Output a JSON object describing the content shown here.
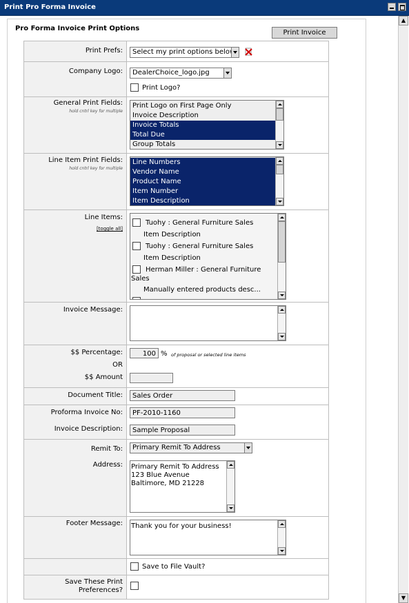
{
  "window": {
    "title": "Print Pro Forma Invoice"
  },
  "heading": "Pro Forma Invoice Print Options",
  "print_button": "Print Invoice",
  "rows": {
    "print_prefs": {
      "label": "Print Prefs:",
      "value": "Select my print options below"
    },
    "company_logo": {
      "label": "Company Logo:",
      "value": "DealerChoice_logo.jpg",
      "print_logo_label": "Print Logo?"
    },
    "general_print_fields": {
      "label": "General Print Fields:",
      "hint": "hold cntrl key for multiple",
      "options": [
        {
          "text": "Print Logo on First Page Only",
          "selected": false
        },
        {
          "text": "Invoice Description",
          "selected": false
        },
        {
          "text": "Invoice Totals",
          "selected": true
        },
        {
          "text": "Total Due",
          "selected": true
        },
        {
          "text": "Group Totals",
          "selected": false
        }
      ]
    },
    "line_item_print_fields": {
      "label": "Line Item Print Fields:",
      "hint": "hold cntrl key for multiple",
      "options": [
        {
          "text": "Line Numbers",
          "selected": true
        },
        {
          "text": "Vendor Name",
          "selected": true
        },
        {
          "text": "Product Name",
          "selected": true
        },
        {
          "text": "Item Number",
          "selected": true
        },
        {
          "text": "Item Description",
          "selected": true
        }
      ]
    },
    "line_items": {
      "label": "Line Items:",
      "toggle": "[toggle all]",
      "items": [
        {
          "vendor": "Tuohy : General Furniture Sales",
          "wrap": "",
          "desc": "Item Description"
        },
        {
          "vendor": "Tuohy : General Furniture Sales",
          "wrap": "",
          "desc": "Item Description"
        },
        {
          "vendor": "Herman Miller : General Furniture",
          "wrap": "Sales",
          "desc": "Manually entered products desc..."
        }
      ]
    },
    "invoice_message": {
      "label": "Invoice Message:",
      "value": ""
    },
    "percentage": {
      "label": "$$ Percentage:",
      "value": "100",
      "unit": "%",
      "note": "of proposal or selected line items",
      "or": "OR"
    },
    "amount": {
      "label": "$$ Amount",
      "value": ""
    },
    "document_title": {
      "label": "Document Title:",
      "value": "Sales Order"
    },
    "proforma_no": {
      "label": "Proforma Invoice No:",
      "value": "PF-2010-1160"
    },
    "invoice_description": {
      "label": "Invoice Description:",
      "value": "Sample Proposal"
    },
    "remit_to": {
      "label": "Remit To:",
      "value": "Primary Remit To Address"
    },
    "address": {
      "label": "Address:",
      "lines": [
        "Primary Remit To Address",
        "123 Blue Avenue",
        "Baltimore, MD 21228"
      ]
    },
    "footer_message": {
      "label": "Footer Message:",
      "value": "Thank you for your business!"
    },
    "file_vault": {
      "label": "Save to File Vault?"
    },
    "save_prefs": {
      "label_line1": "Save These Print",
      "label_line2": "Preferences?"
    }
  }
}
